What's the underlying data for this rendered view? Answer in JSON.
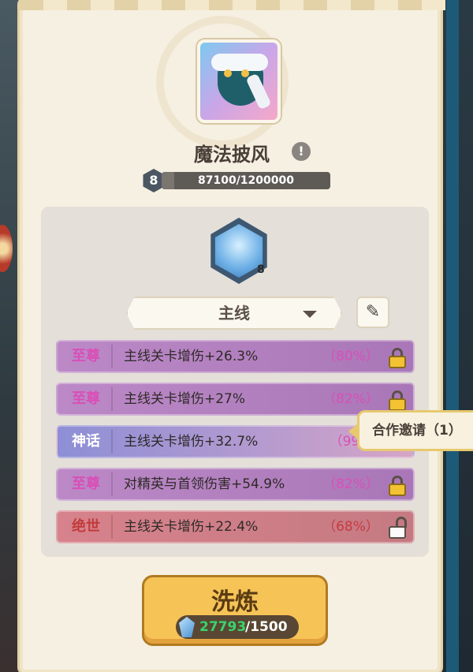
{
  "item": {
    "name": "魔法披风",
    "icon": "cape-icon",
    "level": "8",
    "xp_text": "87100/1200000",
    "xp_progress": 0.0726
  },
  "crystal": {
    "icon": "crystal-icon",
    "level": "8"
  },
  "category": {
    "selected": "主线",
    "edit_icon": "edit-icon"
  },
  "attributes": [
    {
      "tier": "至尊",
      "text": "主线关卡增伤+26.3%",
      "pct": "（80%）",
      "lock": "locked"
    },
    {
      "tier": "至尊",
      "text": "主线关卡增伤+27%",
      "pct": "（82%）",
      "lock": "locked"
    },
    {
      "tier": "神话",
      "text": "主线关卡增伤+32.7%",
      "pct": "（99%",
      "lock": "locked"
    },
    {
      "tier": "至尊",
      "text": "对精英与首领伤害+54.9%",
      "pct": "（82%）",
      "lock": "locked"
    },
    {
      "tier": "绝世",
      "text": "主线关卡增伤+22.4%",
      "pct": "（68%）",
      "lock": "unlocked"
    }
  ],
  "coop": {
    "label": "合作邀请（1）"
  },
  "refine": {
    "label": "洗炼",
    "owned": "27793",
    "cost": "/1500"
  },
  "colors": {
    "tier_supreme": "#d94fb7",
    "tier_myth": "#ffffff",
    "tier_unique": "#c23b3b",
    "currency_owned": "#38d46b",
    "button_gold": "#f6c357"
  }
}
